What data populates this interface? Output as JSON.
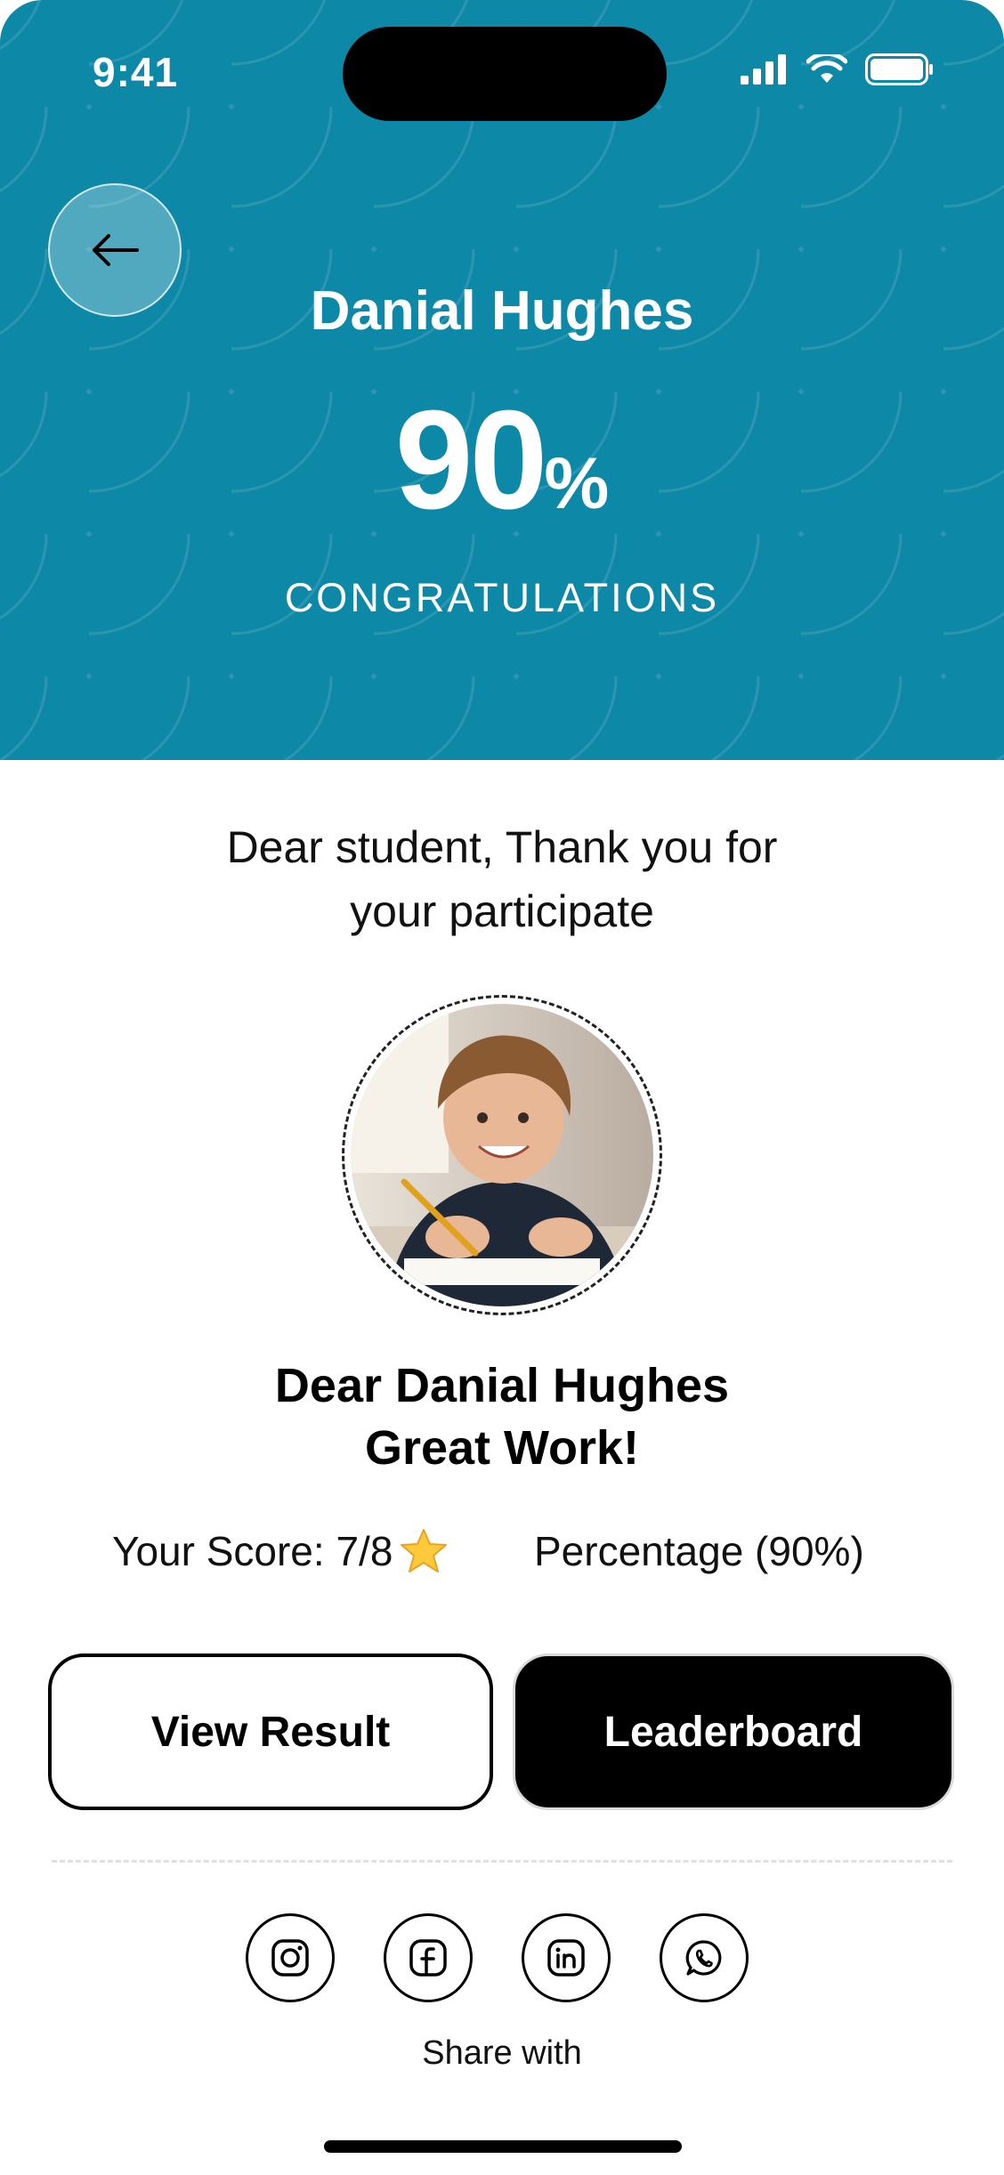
{
  "status_bar": {
    "time": "9:41"
  },
  "header": {
    "student_name": "Danial Hughes",
    "score_value": "90",
    "score_unit": "%",
    "congrats": "CONGRATULATIONS",
    "background_color": "#0E88A7"
  },
  "thanks": {
    "line1": "Dear student, Thank you for",
    "line2": "your participate"
  },
  "greeting": {
    "line1": "Dear Danial Hughes",
    "line2": "Great Work!"
  },
  "stats": {
    "score_text": "Your Score: 7/8",
    "score_icon": "star-icon",
    "percentage_text": "Percentage (90%)"
  },
  "buttons": {
    "view_result": "View Result",
    "leaderboard": "Leaderboard"
  },
  "share": {
    "label": "Share with",
    "networks": [
      "instagram-icon",
      "facebook-icon",
      "linkedin-icon",
      "whatsapp-icon"
    ]
  }
}
